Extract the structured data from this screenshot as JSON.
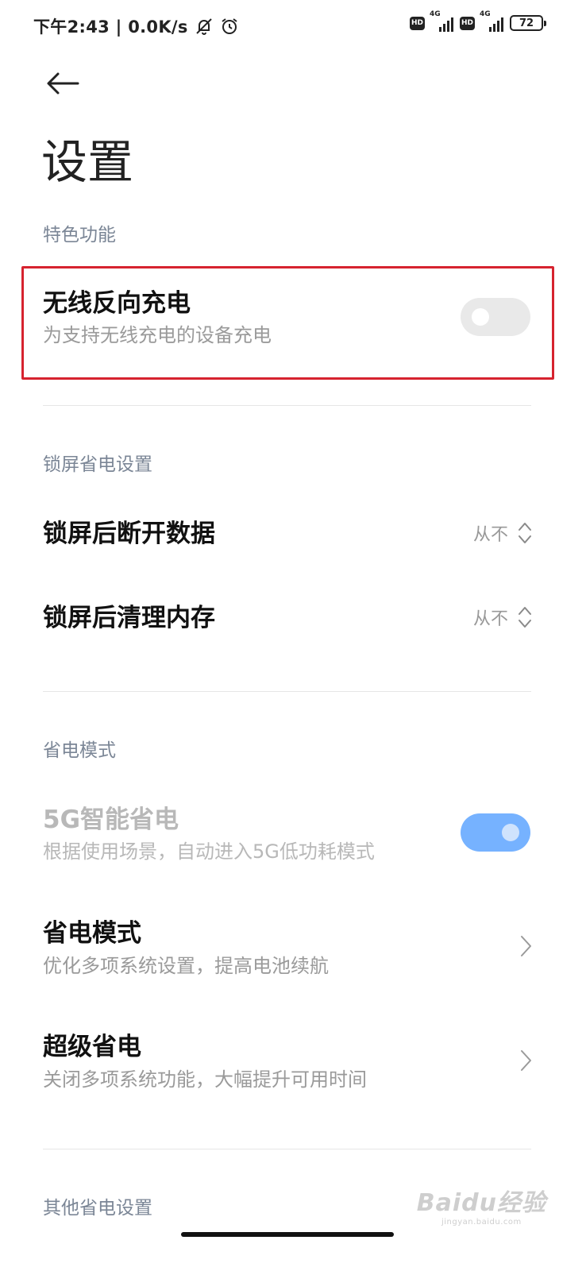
{
  "status_bar": {
    "time_speed": "下午2:43 | 0.0K/s",
    "icons": [
      "mute-bell-icon",
      "alarm-clock-icon",
      "hd-icon",
      "signal-icon",
      "battery-icon"
    ],
    "hd_label": "HD",
    "network_label": "4G",
    "battery_level": "72"
  },
  "header": {
    "back_icon": "back-arrow-icon",
    "title": "设置"
  },
  "sections": {
    "special": {
      "header": "特色功能",
      "wireless_reverse": {
        "title": "无线反向充电",
        "subtitle": "为支持无线充电的设备充电",
        "enabled": false
      }
    },
    "lock_screen": {
      "header": "锁屏省电设置",
      "disconnect_data": {
        "title": "锁屏后断开数据",
        "value": "从不"
      },
      "clean_memory": {
        "title": "锁屏后清理内存",
        "value": "从不"
      }
    },
    "power_mode": {
      "header": "省电模式",
      "smart_5g": {
        "title": "5G智能省电",
        "subtitle": "根据使用场景，自动进入5G低功耗模式",
        "enabled": true,
        "disabled_look": true
      },
      "power_saving": {
        "title": "省电模式",
        "subtitle": "优化多项系统设置，提高电池续航"
      },
      "ultra_saving": {
        "title": "超级省电",
        "subtitle": "关闭多项系统功能，大幅提升可用时间"
      }
    },
    "other": {
      "header": "其他省电设置"
    }
  },
  "watermark": {
    "brand": "Baidu经验",
    "url": "jingyan.baidu.com"
  },
  "colors": {
    "highlight": "#d6232f",
    "toggle_on": "#76b2ff",
    "toggle_off": "#e9e9e9",
    "section_header": "#7b8696"
  }
}
